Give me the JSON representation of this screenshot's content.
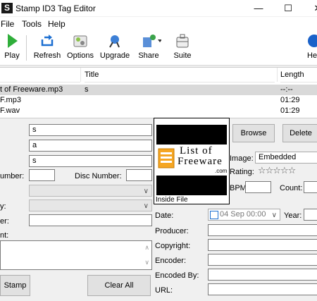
{
  "window": {
    "title": "Stamp ID3 Tag Editor",
    "app_icon_letter": "S",
    "minimize": "—",
    "maximize": "☐",
    "close": "✕"
  },
  "menu": [
    "File",
    "Tools",
    "Help"
  ],
  "toolbar": [
    {
      "label": "Play",
      "icon": "play-icon"
    },
    {
      "label": "Refresh",
      "icon": "refresh-icon"
    },
    {
      "label": "Options",
      "icon": "options-icon"
    },
    {
      "label": "Upgrade",
      "icon": "upgrade-icon"
    },
    {
      "label": "Share",
      "icon": "share-icon"
    },
    {
      "label": "Suite",
      "icon": "suite-icon"
    },
    {
      "label": "He",
      "icon": "help-icon"
    }
  ],
  "filelist": {
    "columns": [
      "Title",
      "Length"
    ],
    "rows": [
      {
        "name": "t of Freeware.mp3",
        "title": "s",
        "length": "--:--",
        "selected": true
      },
      {
        "name": "F.mp3",
        "title": "",
        "length": "01:29",
        "selected": false
      },
      {
        "name": "F.wav",
        "title": "",
        "length": "01:29",
        "selected": false
      }
    ]
  },
  "fields": {
    "title_value": "s",
    "artist_value": "a",
    "album_value": "s",
    "track_number_label": "umber:",
    "disc_number_label": "Disc Number:",
    "genre_label": "y:",
    "composer_label": "er:",
    "comment_label": "nt:",
    "date_label": "Date:",
    "date_value": "04 Sep 00:00",
    "year_label": "Year:",
    "producer_label": "Producer:",
    "copyright_label": "Copyright:",
    "encoder_label": "Encoder:",
    "encoded_by_label": "Encoded By:",
    "url_label": "URL:"
  },
  "art": {
    "caption": "Inside File",
    "logo_line1": "List of",
    "logo_line2": "Freeware",
    "logo_line3": ".com",
    "browse": "Browse",
    "delete": "Delete",
    "image_label": "Image:",
    "image_value": "Embedded",
    "rating_label": "Rating:",
    "rating_stars": "☆☆☆☆☆",
    "bpm_label": "BPM:",
    "count_label": "Count:"
  },
  "buttons": {
    "stamp": "Stamp",
    "clear_all": "Clear All"
  }
}
